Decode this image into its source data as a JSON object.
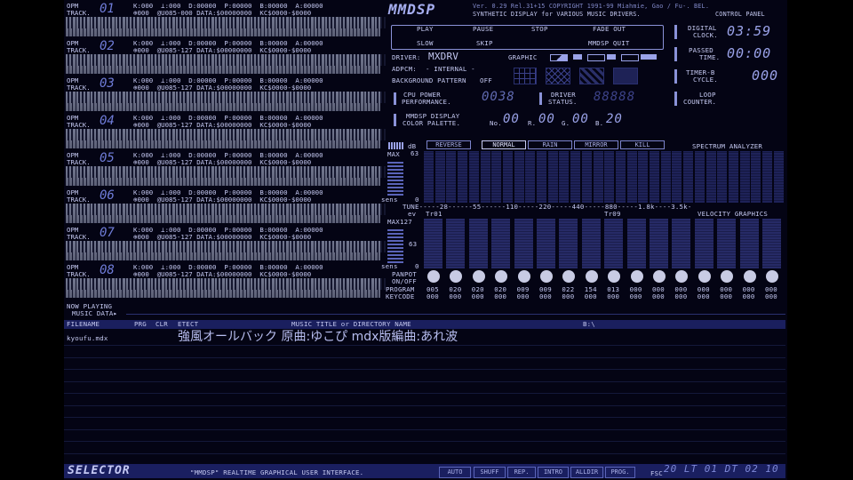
{
  "app": {
    "logo": "MMDSP",
    "version_line": "Ver. 0.29 Rel.31+15 COPYRIGHT 1991-99 Miahmie, Gao / Fu-. BEL.",
    "subtitle": "SYNTHETIC DISPLAY for VARIOUS MUSIC DRIVERS.",
    "control_panel": "CONTROL PANEL"
  },
  "tracks": [
    {
      "opm": "OPM",
      "track_label": "TRACK.",
      "num": "01",
      "line1": "K:000  ⊥:000  D:00000  P:00000  B:00000  A:00000",
      "line2": "⊕000  @U085-000 DATA:$00000000  KC$0000-$0000"
    },
    {
      "opm": "OPM",
      "track_label": "TRACK.",
      "num": "02",
      "line1": "K:000  ⊥:000  D:00000  P:00000  B:00000  A:00000",
      "line2": "⊕000  @U085-127 DATA:$00000000  KC$0000-$0000"
    },
    {
      "opm": "OPM",
      "track_label": "TRACK.",
      "num": "03",
      "line1": "K:000  ⊥:000  D:00000  P:00000  B:00000  A:00000",
      "line2": "⊕000  @U085-127 DATA:$00000000  KC$0000-$0000"
    },
    {
      "opm": "OPM",
      "track_label": "TRACK.",
      "num": "04",
      "line1": "K:000  ⊥:000  D:00000  P:00000  B:00000  A:00000",
      "line2": "⊕000  @U085-127 DATA:$00000000  KC$0000-$0000"
    },
    {
      "opm": "OPM",
      "track_label": "TRACK.",
      "num": "05",
      "line1": "K:000  ⊥:000  D:00000  P:00000  B:00000  A:00000",
      "line2": "⊕000  @U085-127 DATA:$00000000  KC$0000-$0000"
    },
    {
      "opm": "OPM",
      "track_label": "TRACK.",
      "num": "06",
      "line1": "K:000  ⊥:000  D:00000  P:00000  B:00000  A:00000",
      "line2": "⊕000  @U085-127 DATA:$00000000  KC$0000-$0000"
    },
    {
      "opm": "OPM",
      "track_label": "TRACK.",
      "num": "07",
      "line1": "K:000  ⊥:000  D:00000  P:00000  B:00000  A:00000",
      "line2": "⊕000  @U085-127 DATA:$00000000  KC$0000-$0000"
    },
    {
      "opm": "OPM",
      "track_label": "TRACK.",
      "num": "08",
      "line1": "K:000  ⊥:000  D:00000  P:00000  B:00000  A:00000",
      "line2": "⊕000  @U085-127 DATA:$00000000  KC$0000-$0000"
    }
  ],
  "controls": {
    "play": "PLAY",
    "pause": "PAUSE",
    "stop": "STOP",
    "fade_out": "FADE OUT",
    "slow": "SLOW",
    "skip": "SKIP",
    "mmdsp_quit": "MMDSP QUIT"
  },
  "driver": {
    "label": "DRIVER:",
    "value": "MXDRV",
    "graphic_label": "GRAPHIC"
  },
  "adpcm": {
    "label": "ADPCM:",
    "value": "- INTERNAL -"
  },
  "bg_pattern": {
    "label": "BACKGROUND PATTERN",
    "value": "OFF"
  },
  "clock": {
    "digital_label_1": "DIGITAL",
    "digital_label_2": "CLOCK.",
    "digital_value": "03:59",
    "passed_label_1": "PASSED",
    "passed_label_2": "TIME.",
    "passed_value": "00:00",
    "timerb_label_1": "TIMER-B",
    "timerb_label_2": "CYCLE.",
    "timerb_value": "000",
    "loop_label_1": "LOOP",
    "loop_label_2": "COUNTER."
  },
  "cpu": {
    "label_1": "CPU POWER",
    "label_2": "PERFORMANCE.",
    "value": "0038"
  },
  "driver_status": {
    "label_1": "DRIVER",
    "label_2": "STATUS.",
    "value": "88888"
  },
  "palette": {
    "label_1": "MMDSP DISPLAY",
    "label_2": "COLOR PALETTE.",
    "no_label": "No.",
    "no_value": "00",
    "r_label": "R.",
    "r_value": "00",
    "g_label": "G.",
    "g_value": "00",
    "b_label": "B.",
    "b_value": "20"
  },
  "spectrum": {
    "tabs": [
      "REVERSE",
      "NORMAL",
      "RAIN",
      "MIRROR",
      "KILL"
    ],
    "title": "SPECTRUM ANALYZER",
    "db_label": "dB",
    "max_label": "MAX",
    "max_value": "63",
    "sens_label": "sens",
    "zero": "0",
    "tune_line": "TUNE-----28------55------110-----220-----440-----880-----1.8k----3.5k-"
  },
  "velocity": {
    "ev_label": "ev",
    "tr_start": "Tr01",
    "tr_mid": "Tr09",
    "title": "VELOCITY GRAPHICS",
    "max_label": "MAX127",
    "mid_value": "63",
    "sens_label": "sens",
    "zero": "0"
  },
  "panpot": {
    "label_1": "PANPOT",
    "label_2": "ON/OFF",
    "program_label": "PROGRAM",
    "programs": [
      "005",
      "020",
      "020",
      "020",
      "009",
      "009",
      "022",
      "154",
      "013",
      "000",
      "000",
      "000",
      "000",
      "000",
      "000",
      "000"
    ],
    "keycode_label": "KEYCODE",
    "keycodes": [
      "000",
      "000",
      "000",
      "000",
      "000",
      "000",
      "000",
      "000",
      "000",
      "000",
      "000",
      "000",
      "000",
      "000",
      "000",
      "000"
    ]
  },
  "now_playing": {
    "label_1": "NOW PLAYING",
    "label_2": "MUSIC DATA▸"
  },
  "file_header": {
    "filename": "FILENAME",
    "prg": "PRG",
    "clr": "CLR",
    "etect": "ETECT",
    "title": "MUSIC TITLE or DIRECTORY NAME",
    "path": "B:\\"
  },
  "file_row": {
    "filename": "kyoufu.mdx",
    "title": "強風オールバック 原曲:ゆこぴ mdx版編曲:あれ波"
  },
  "selector": {
    "logo": "SELECTOR",
    "caption": "\"MMDSP\" REALTIME GRAPHICAL USER INTERFACE.",
    "buttons": [
      "AUTO",
      "SHUFF",
      "REP.",
      "INTRO",
      "ALLDIR",
      "PROG."
    ],
    "date_label": "FSC",
    "date_value": "20 LT 01 DT 02 10"
  },
  "colors": {
    "accent": "#8a92d8",
    "bg": "#040414",
    "text": "#c4c8f0"
  }
}
